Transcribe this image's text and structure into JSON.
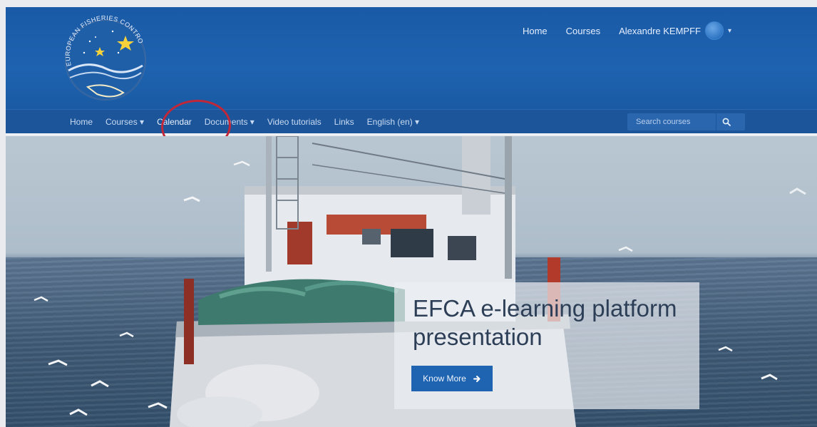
{
  "header": {
    "logo_text": "EUROPEAN FISHERIES CONTROL AGENCY",
    "top_nav": {
      "home": "Home",
      "courses": "Courses"
    },
    "user": {
      "name": "Alexandre KEMPFF",
      "caret": "▾"
    }
  },
  "navbar": {
    "items": [
      {
        "label": "Home"
      },
      {
        "label": "Courses ▾"
      },
      {
        "label": "Calendar"
      },
      {
        "label": "Documents ▾"
      },
      {
        "label": "Video tutorials"
      },
      {
        "label": "Links"
      },
      {
        "label": "English (en) ▾"
      }
    ],
    "search": {
      "placeholder": "Search courses"
    }
  },
  "hero": {
    "title": "EFCA e-learning platform presentation",
    "button_label": "Know More"
  },
  "colors": {
    "header_blue": "#1e63b0",
    "navbar_blue": "#1c5599",
    "accent_blue": "#1f64b0",
    "annotation_red": "#c0283a"
  },
  "icons": {
    "search": "magnifier-icon",
    "arrow": "arrow-right-icon"
  }
}
